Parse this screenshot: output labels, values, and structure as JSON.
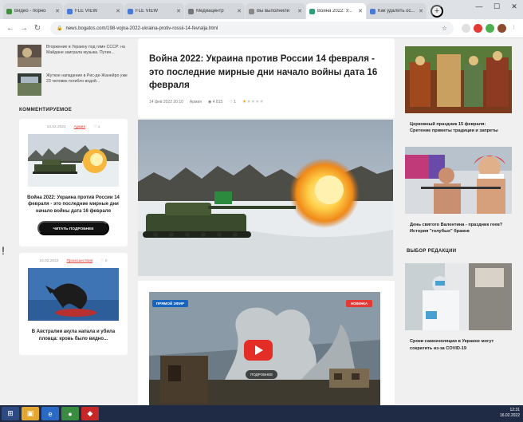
{
  "browser": {
    "tabs": [
      {
        "label": "Видео - порно",
        "fav": "#3f8f3f",
        "active": false
      },
      {
        "label": "FLE VIEW",
        "fav": "#4a79d8",
        "active": false
      },
      {
        "label": "FLE VIEW",
        "fav": "#4a79d8",
        "active": false
      },
      {
        "label": "Медиацентр",
        "fav": "#777777",
        "active": false
      },
      {
        "label": "Вы выполнили",
        "fav": "#888888",
        "active": false
      },
      {
        "label": "Война 2022: У...",
        "fav": "#2e9e7a",
        "active": true
      },
      {
        "label": "Как удалить ос...",
        "fav": "#4a79d8",
        "active": false
      }
    ],
    "new_tab": "+",
    "url": "news.bogatos.com/198-vojna-2022-ukraina-protiv-rossii-14-fevralja.html"
  },
  "left": {
    "minis": [
      {
        "text": "Вторжение в Украину под гимн СССР: на Майдане заиграла музыка. Путин..."
      },
      {
        "text": "Жуткое нападение в Рис-де-Жанейро уже 23 человек погибло водой..."
      }
    ],
    "section": "КОММЕНТИРУЕМОЕ",
    "card1": {
      "date": "14.02.2022",
      "cat": "Армия",
      "comments": "1",
      "title": "Война 2022: Украина против России 14 февраля - это последние мирные дни начало войны дата 16 февраля",
      "button": "ЧИТАТЬ ПОДРОБНЕЕ"
    },
    "card2": {
      "date": "16.02.2022",
      "cat": "Происшествия",
      "comments": "0",
      "title": "В Австралии акула напала и убила пловца: кровь было видно..."
    }
  },
  "main": {
    "title": "Война 2022: Украина против России 14 февраля - это последние мирные дни начало войны дата 16 февраля",
    "date": "14 фев 2022 20:10",
    "category": "Армия",
    "views": "4 815",
    "comments": "1",
    "rating": 1,
    "video": {
      "badge": "ПРЯМОЙ ЭФИР",
      "badge2": "НОВИНКА",
      "label": "ПОДРОБНЕЕ"
    }
  },
  "right": {
    "items": [
      {
        "title": "Церковный праздник 15 февраля: Сретение приметы традиции и запреты"
      },
      {
        "title": "День святого Валентина - праздник геев? История \"голубых\" браков"
      }
    ],
    "section": "ВЫБОР РЕДАКЦИИ",
    "pick": {
      "title": "Сроки самоизоляции в Украине могут сократить из-за COVID-19"
    }
  },
  "taskbar": {
    "time": "12:31",
    "date": "16.02.2022"
  },
  "stray": "!"
}
